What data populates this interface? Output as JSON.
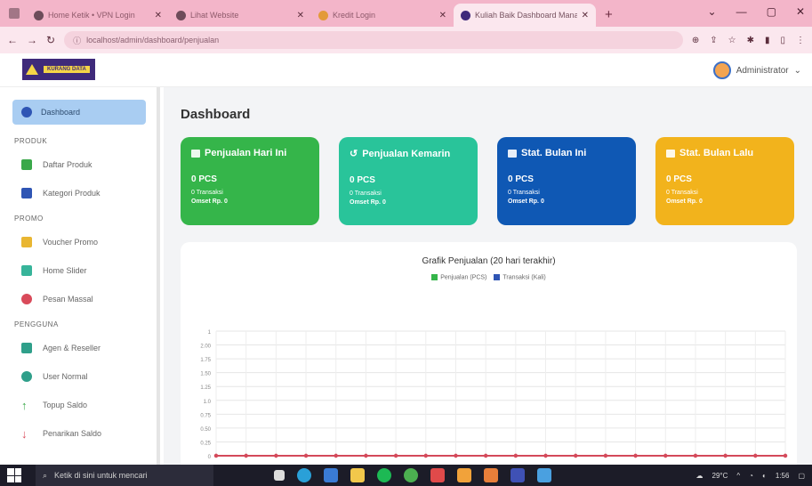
{
  "browser": {
    "tabs": [
      {
        "label": "Home Ketik • VPN Login",
        "active": false
      },
      {
        "label": "Lihat Website",
        "active": false
      },
      {
        "label": "Kredit Login",
        "active": false
      },
      {
        "label": "Kuliah Baik Dashboard Manage",
        "active": true
      }
    ],
    "new_tab_icon": "+",
    "url": "localhost/admin/dashboard/penjualan"
  },
  "header": {
    "brand": "KURANG DATA",
    "user_name": "Administrator"
  },
  "sidebar": {
    "active_item": "Dashboard",
    "sections": [
      {
        "title": "PRODUK",
        "items": [
          {
            "label": "Daftar Produk",
            "icon": "product-icon",
            "color": "#3aa84a"
          },
          {
            "label": "Kategori Produk",
            "icon": "category-icon",
            "color": "#2f55b4"
          }
        ]
      },
      {
        "title": "PROMO",
        "items": [
          {
            "label": "Voucher Promo",
            "icon": "voucher-icon",
            "color": "#e9b632"
          },
          {
            "label": "Home Slider",
            "icon": "slider-icon",
            "color": "#37b49a"
          },
          {
            "label": "Pesan Massal",
            "icon": "message-icon",
            "color": "#d94a5a"
          }
        ]
      },
      {
        "title": "PENGGUNA",
        "items": [
          {
            "label": "Agen & Reseller",
            "icon": "agent-icon",
            "color": "#2f9f8a"
          },
          {
            "label": "User Normal",
            "icon": "user-icon",
            "color": "#2f9f8a"
          },
          {
            "label": "Topup Saldo",
            "icon": "topup-icon",
            "color": "#3aa84a"
          },
          {
            "label": "Penarikan Saldo",
            "icon": "withdraw-icon",
            "color": "#d94a5a"
          }
        ]
      }
    ]
  },
  "main": {
    "title": "Dashboard",
    "cards": [
      {
        "title": "Penjualan Hari Ini",
        "value": "0 PCS",
        "sub": "0 Transaksi",
        "omzet": "Omset Rp. 0",
        "color": "#35b54a"
      },
      {
        "title": "Penjualan Kemarin",
        "value": "0 PCS",
        "sub": "0 Transaksi",
        "omzet": "Omset Rp. 0",
        "color": "#29c49a"
      },
      {
        "title": "Stat. Bulan Ini",
        "value": "0 PCS",
        "sub": "0 Transaksi",
        "omzet": "Omset Rp. 0",
        "color": "#0f58b4"
      },
      {
        "title": "Stat. Bulan Lalu",
        "value": "0 PCS",
        "sub": "0 Transaksi",
        "omzet": "Omset Rp. 0",
        "color": "#f2b31c"
      }
    ]
  },
  "chart_data": {
    "type": "line",
    "title": "Grafik Penjualan (20 hari terakhir)",
    "series": [
      {
        "name": "Penjualan (PCS)",
        "color": "#35b54a",
        "values": [
          0,
          0,
          0,
          0,
          0,
          0,
          0,
          0,
          0,
          0,
          0,
          0,
          0,
          0,
          0,
          0,
          0,
          0,
          0,
          0
        ]
      },
      {
        "name": "Transaksi (Kali)",
        "color": "#2f55b4",
        "values": [
          0,
          0,
          0,
          0,
          0,
          0,
          0,
          0,
          0,
          0,
          0,
          0,
          0,
          0,
          0,
          0,
          0,
          0,
          0,
          0
        ]
      }
    ],
    "ytick_labels": [
      "1",
      "2.00",
      "1.75",
      "1.50",
      "1.25",
      "1.0",
      "0.75",
      "0.50",
      "0.25",
      "0"
    ],
    "ylim": [
      0,
      2
    ],
    "grid": true,
    "line_color": "#d4495a"
  },
  "taskbar": {
    "search_placeholder": "Ketik di sini untuk mencari",
    "tray_text": "29°C",
    "clock": "1:56"
  }
}
